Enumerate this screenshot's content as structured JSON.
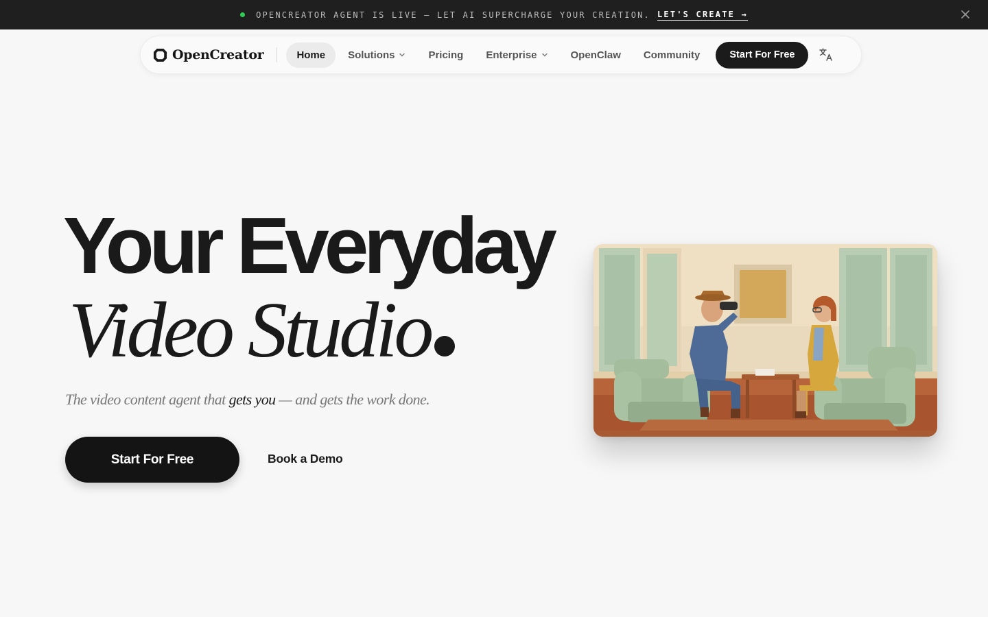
{
  "banner": {
    "message": "OPENCREATOR AGENT IS LIVE — LET AI SUPERCHARGE YOUR CREATION.",
    "cta": "LET'S CREATE →",
    "status_color": "#2ecc54"
  },
  "nav": {
    "brand": "OpenCreator",
    "items": [
      {
        "label": "Home",
        "active": true
      },
      {
        "label": "Solutions",
        "has_dropdown": true
      },
      {
        "label": "Pricing"
      },
      {
        "label": "Enterprise",
        "has_dropdown": true
      },
      {
        "label": "OpenClaw"
      },
      {
        "label": "Community"
      }
    ],
    "cta": "Start For Free",
    "language_icon": "translate-icon"
  },
  "hero": {
    "title_line1": "Your Everyday",
    "title_line2": "Video Studio",
    "subtitle_before": "The video content agent that ",
    "subtitle_emphasis": "gets you",
    "subtitle_after": " — and gets the work done.",
    "primary_button": "Start For Free",
    "secondary_button": "Book a Demo",
    "image_icon": "hero-scene-image"
  },
  "colors": {
    "background": "#f7f7f7",
    "banner_bg": "#1f1f1f",
    "dark": "#141414"
  }
}
